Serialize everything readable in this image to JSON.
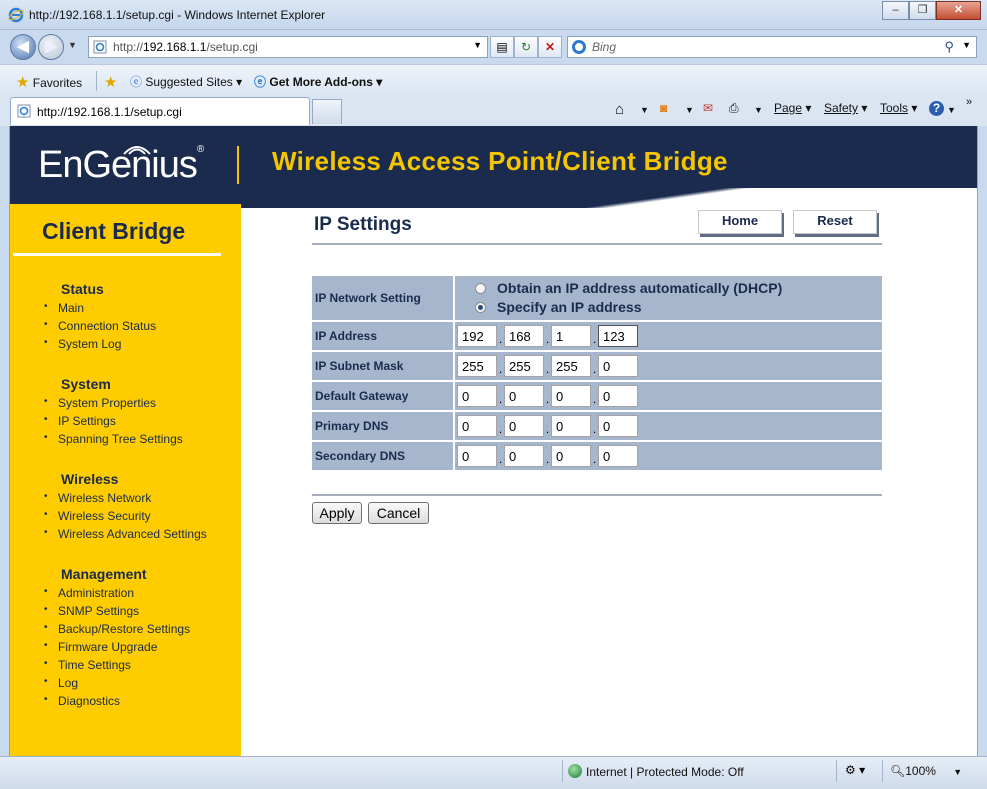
{
  "window": {
    "title": "http://192.168.1.1/setup.cgi - Windows Internet Explorer",
    "minimize": "–",
    "restore": "❐",
    "close": "✕"
  },
  "address": {
    "url_prefix": "http://",
    "url_host": "192.168.1.1",
    "url_path": "/setup.cgi",
    "search_placeholder": "Bing"
  },
  "favorites_bar": {
    "favorites": "Favorites",
    "suggested": "Suggested Sites ▾",
    "addons": "Get More Add-ons ▾"
  },
  "tab": {
    "label": "http://192.168.1.1/setup.cgi"
  },
  "command_bar": {
    "page": "Page",
    "safety": "Safety",
    "tools": "Tools"
  },
  "banner": {
    "logo": "EnGenius",
    "logo_mark": "®",
    "product": "Wireless Access Point/Client Bridge"
  },
  "sidebar": {
    "title": "Client Bridge",
    "groups": [
      {
        "title": "Status",
        "items": [
          "Main",
          "Connection Status",
          "System Log"
        ]
      },
      {
        "title": "System",
        "items": [
          "System Properties",
          "IP Settings",
          "Spanning Tree Settings"
        ]
      },
      {
        "title": "Wireless",
        "items": [
          "Wireless Network",
          "Wireless Security",
          "Wireless Advanced Settings"
        ]
      },
      {
        "title": "Management",
        "items": [
          "Administration",
          "SNMP Settings",
          "Backup/Restore Settings",
          "Firmware Upgrade",
          "Time Settings",
          "Log",
          "Diagnostics"
        ]
      }
    ]
  },
  "main": {
    "heading": "IP Settings",
    "home_button": "Home",
    "reset_button": "Reset",
    "network_setting_label": "IP Network Setting",
    "option_dhcp": "Obtain an IP address automatically (DHCP)",
    "option_static": "Specify an IP address",
    "selected_option": "static",
    "rows": [
      {
        "label": "IP Address",
        "octets": [
          "192",
          "168",
          "1",
          "123"
        ]
      },
      {
        "label": "IP Subnet Mask",
        "octets": [
          "255",
          "255",
          "255",
          "0"
        ]
      },
      {
        "label": "Default Gateway",
        "octets": [
          "0",
          "0",
          "0",
          "0"
        ]
      },
      {
        "label": "Primary DNS",
        "octets": [
          "0",
          "0",
          "0",
          "0"
        ]
      },
      {
        "label": "Secondary DNS",
        "octets": [
          "0",
          "0",
          "0",
          "0"
        ]
      }
    ],
    "apply_button": "Apply",
    "cancel_button": "Cancel"
  },
  "statusbar": {
    "zone": "Internet | Protected Mode: Off",
    "zoom": "100%"
  },
  "colors": {
    "navy": "#1a2b4d",
    "yellow": "#ffcc00",
    "row_bg": "#a6b7cd"
  }
}
